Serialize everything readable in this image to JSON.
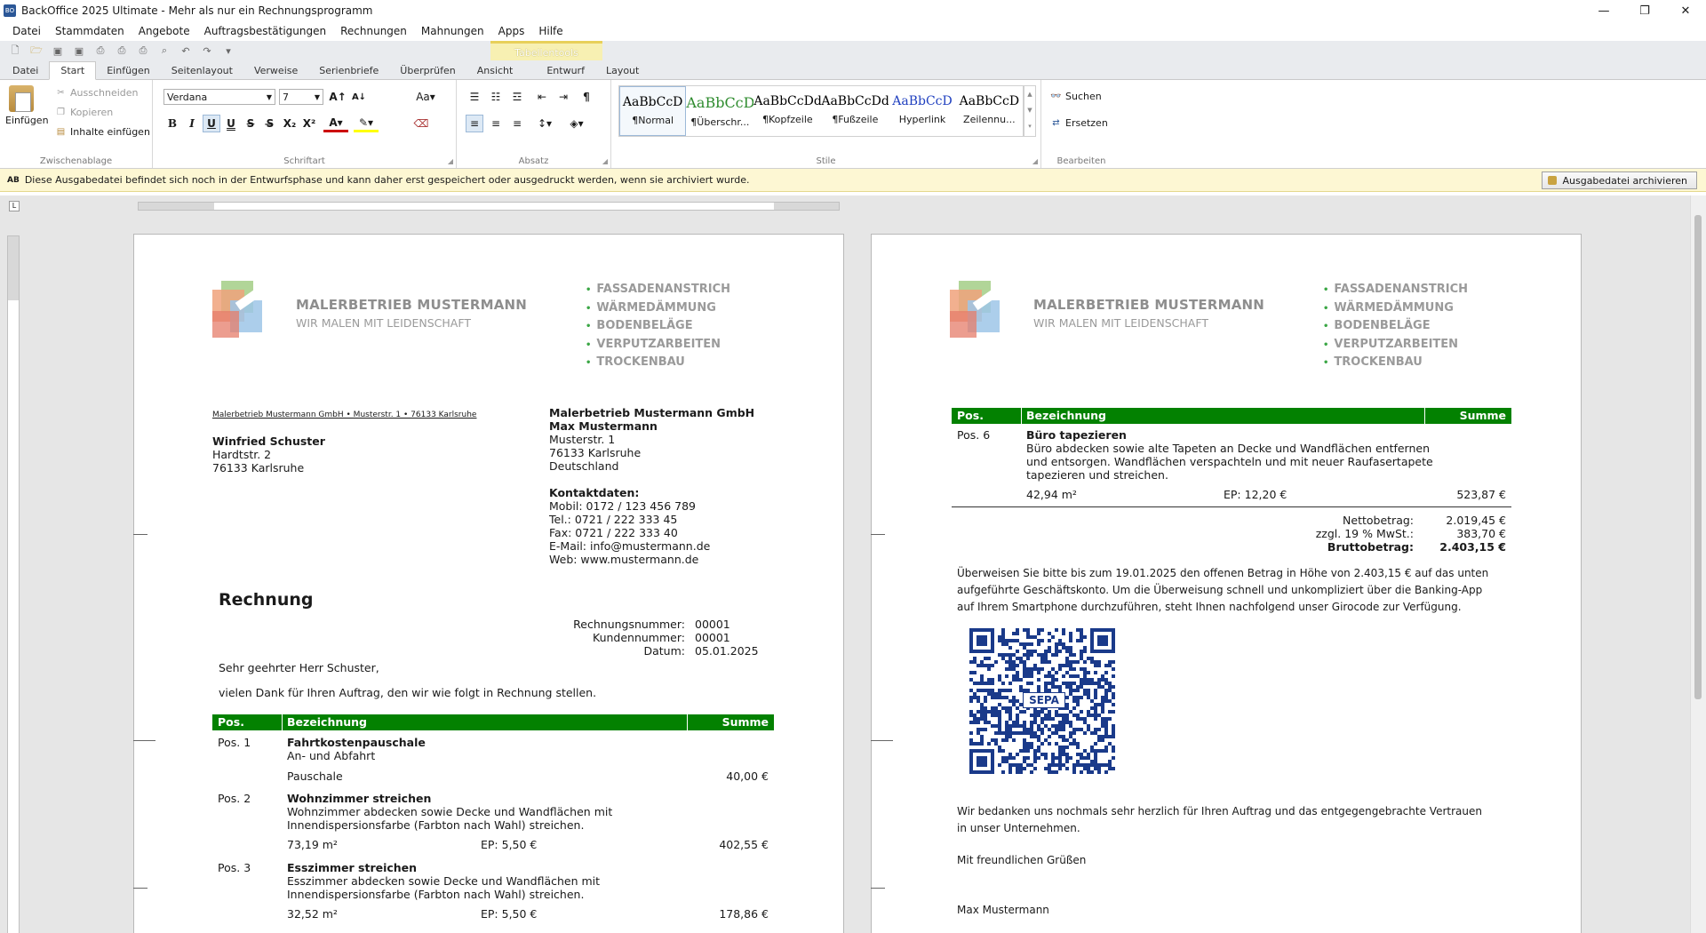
{
  "window": {
    "title": "BackOffice 2025 Ultimate - Mehr als nur ein Rechnungsprogramm",
    "app_icon": "BO"
  },
  "menu": [
    "Datei",
    "Stammdaten",
    "Angebote",
    "Auftragsbestätigungen",
    "Rechnungen",
    "Mahnungen",
    "Apps",
    "Hilfe"
  ],
  "context_tab": "Tabellentools",
  "tabs": [
    "Datei",
    "Start",
    "Einfügen",
    "Seitenlayout",
    "Verweise",
    "Serienbriefe",
    "Überprüfen",
    "Ansicht",
    "Entwurf",
    "Layout"
  ],
  "ribbon": {
    "clipboard": {
      "paste": "Einfügen",
      "cut": "Ausschneiden",
      "copy": "Kopieren",
      "paste_contents": "Inhalte einfügen",
      "label": "Zwischenablage"
    },
    "font": {
      "family": "Verdana",
      "size": "7",
      "label": "Schriftart",
      "case": "Aa"
    },
    "paragraph": {
      "label": "Absatz"
    },
    "styles": {
      "label": "Stile",
      "items": [
        {
          "preview": "AaBbCcD",
          "name": "¶Normal",
          "color": "#000000"
        },
        {
          "preview": "AaBbCcD",
          "name": "¶Überschr...",
          "color": "#2e8b2e"
        },
        {
          "preview": "AaBbCcDdE",
          "name": "¶Kopfzeile",
          "color": "#000000"
        },
        {
          "preview": "AaBbCcDdE",
          "name": "¶Fußzeile",
          "color": "#000000"
        },
        {
          "preview": "AaBbCcD",
          "name": "Hyperlink",
          "color": "#1f3fbf"
        },
        {
          "preview": "AaBbCcD",
          "name": "Zeilennu...",
          "color": "#000000"
        }
      ]
    },
    "edit": {
      "search": "Suchen",
      "replace": "Ersetzen",
      "label": "Bearbeiten"
    }
  },
  "infobar": {
    "badge": "AB",
    "text": "Diese Ausgabedatei befindet sich noch in der Entwurfsphase und kann daher erst gespeichert oder ausgedruckt werden, wenn sie archiviert wurde.",
    "button": "Ausgabedatei archivieren"
  },
  "company": {
    "name": "MALERBETRIEB MUSTERMANN",
    "slogan": "WIR MALEN MIT LEIDENSCHAFT",
    "services": [
      "FASSADENANSTRICH",
      "WÄRMEDÄMMUNG",
      "BODENBELÄGE",
      "VERPUTZARBEITEN",
      "TROCKENBAU"
    ]
  },
  "page1": {
    "sender_line": "Malerbetrieb Mustermann GmbH • Musterstr. 1 • 76133 Karlsruhe",
    "recipient": [
      "Winfried Schuster",
      "Hardtstr. 2",
      "76133 Karlsruhe"
    ],
    "sender_block": [
      "Malerbetrieb Mustermann GmbH",
      "Max Mustermann",
      "Musterstr. 1",
      "76133 Karlsruhe",
      "Deutschland"
    ],
    "contact_title": "Kontaktdaten:",
    "contact": [
      "Mobil: 0172 / 123 456 789",
      "Tel.: 0721 / 222 333 45",
      "Fax: 0721 / 222 333 40",
      "E-Mail: info@mustermann.de",
      "Web: www.mustermann.de"
    ],
    "doc_title": "Rechnung",
    "meta": [
      {
        "k": "Rechnungsnummer:",
        "v": "00001"
      },
      {
        "k": "Kundennummer:",
        "v": "00001"
      },
      {
        "k": "Datum:",
        "v": "05.01.2025"
      }
    ],
    "salutation": "Sehr geehrter Herr Schuster,",
    "intro": "vielen Dank für Ihren Auftrag, den wir wie folgt in Rechnung stellen.",
    "table_head": {
      "pos": "Pos.",
      "desc": "Bezeichnung",
      "sum": "Summe"
    },
    "items": [
      {
        "pos": "Pos. 1",
        "title": "Fahrtkostenpauschale",
        "desc": [
          "An- und Abfahrt"
        ],
        "qty": "Pauschale",
        "ep": "",
        "sum": "40,00 €"
      },
      {
        "pos": "Pos. 2",
        "title": "Wohnzimmer streichen",
        "desc": [
          "Wohnzimmer abdecken sowie Decke und Wandflächen mit",
          "Innendispersionsfarbe (Farbton nach Wahl) streichen."
        ],
        "qty": "73,19 m²",
        "ep": "EP: 5,50 €",
        "sum": "402,55 €"
      },
      {
        "pos": "Pos. 3",
        "title": "Esszimmer streichen",
        "desc": [
          "Esszimmer abdecken sowie Decke und Wandflächen mit",
          "Innendispersionsfarbe (Farbton nach Wahl) streichen."
        ],
        "qty": "32,52 m²",
        "ep": "EP: 5,50 €",
        "sum": "178,86 €"
      }
    ]
  },
  "page2": {
    "table_head": {
      "pos": "Pos.",
      "desc": "Bezeichnung",
      "sum": "Summe"
    },
    "item": {
      "pos": "Pos. 6",
      "title": "Büro tapezieren",
      "desc": [
        "Büro abdecken sowie alte Tapeten an Decke und Wandflächen entfernen",
        "und entsorgen. Wandflächen verspachteln und mit neuer Raufasertapete",
        "tapezieren und streichen."
      ],
      "qty": "42,94 m²",
      "ep": "EP: 12,20 €",
      "sum": "523,87 €"
    },
    "totals": [
      {
        "k": "Nettobetrag:",
        "v": "2.019,45 €"
      },
      {
        "k": "zzgl. 19 % MwSt.:",
        "v": "383,70 €"
      },
      {
        "k": "Bruttobetrag:",
        "v": "2.403,15 €"
      }
    ],
    "payment": [
      "Überweisen Sie bitte bis zum 19.01.2025 den offenen Betrag in Höhe von 2.403,15 € auf das unten",
      "aufgeführte Geschäftskonto. Um die Überweisung schnell und unkompliziert über die Banking-App",
      "auf Ihrem Smartphone durchzuführen, steht Ihnen nachfolgend unser Girocode zur Verfügung."
    ],
    "qr_label": "SEPA",
    "thanks": [
      "Wir bedanken uns nochmals sehr herzlich für Ihren Auftrag und das entgegengebrachte Vertrauen",
      "in unser Unternehmen."
    ],
    "closing": "Mit freundlichen Grüßen",
    "signature": "Max Mustermann"
  }
}
